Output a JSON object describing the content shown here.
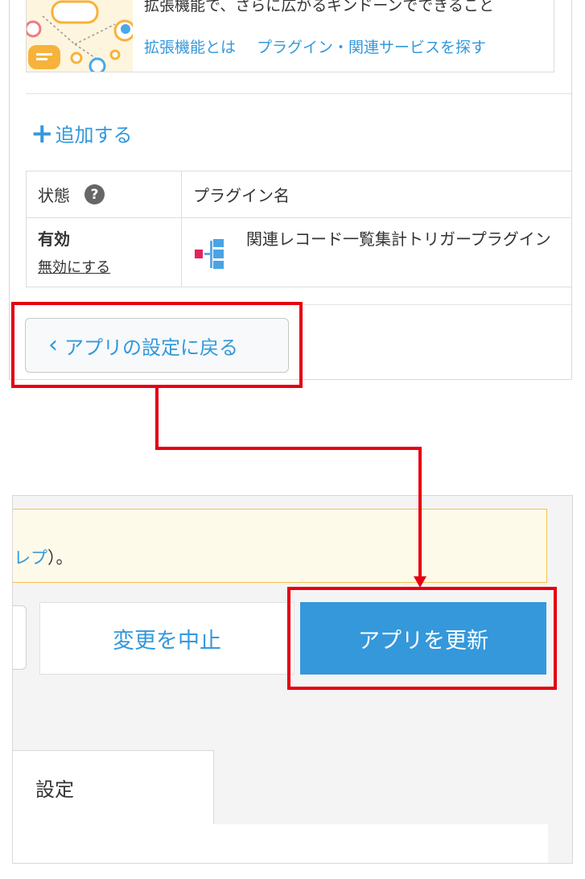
{
  "banner": {
    "text": "拡張機能で、さらに広がるギンドーンでできること",
    "links": [
      "拡張機能とは",
      "プラグイン・関連サービスを探す"
    ]
  },
  "add_link": "追加する",
  "table": {
    "headers": {
      "state": "状態",
      "plugin_name": "プラグイン名"
    },
    "help_icon": "?",
    "rows": [
      {
        "state": "有効",
        "action": "無効にする",
        "plugin_name": "関連レコード一覧集計トリガープラグイン"
      }
    ]
  },
  "back_button": {
    "chevron": "く",
    "label": "アプリの設定に戻る"
  },
  "notice": {
    "link_text": "レプ",
    "suffix": "）。"
  },
  "actions": {
    "cancel": "変更を中止",
    "update": "アプリを更新"
  },
  "tabs": {
    "settings": "設定"
  },
  "colors": {
    "accent": "#3498db",
    "annotation": "#e60012",
    "notice_bg": "#fefaea",
    "notice_border": "#f4c44b",
    "plugin_icon_pink": "#e0245e"
  }
}
